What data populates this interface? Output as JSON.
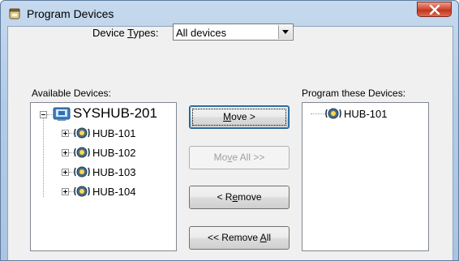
{
  "window": {
    "title": "Program Devices",
    "close_label": "X"
  },
  "device_types": {
    "label_before": "Device ",
    "label_accel": "T",
    "label_after": "ypes:",
    "selected": "All devices",
    "icon": "chevron-down-icon"
  },
  "available": {
    "label": "Available Devices:",
    "root": {
      "label": "SYSHUB-201",
      "icon": "computer-icon",
      "expanded": true
    },
    "children": [
      {
        "label": "HUB-101",
        "icon": "hub-device-icon"
      },
      {
        "label": "HUB-102",
        "icon": "hub-device-icon"
      },
      {
        "label": "HUB-103",
        "icon": "hub-device-icon"
      },
      {
        "label": "HUB-104",
        "icon": "hub-device-icon"
      }
    ]
  },
  "program": {
    "label": "Program these Devices:",
    "items": [
      {
        "label": "HUB-101",
        "icon": "hub-device-icon"
      }
    ]
  },
  "buttons": {
    "move": {
      "pre": "",
      "accel": "M",
      "post": "ove >"
    },
    "move_all": {
      "pre": "Mo",
      "accel": "v",
      "post": "e All >>"
    },
    "remove": {
      "pre": "< R",
      "accel": "e",
      "post": "move"
    },
    "remove_all": {
      "pre": "<< Remove ",
      "accel": "A",
      "post": "ll"
    }
  },
  "colors": {
    "close_button": "#c9452e",
    "title_bar": "#b9d0ea",
    "dialog_face": "#f0f0f0"
  }
}
